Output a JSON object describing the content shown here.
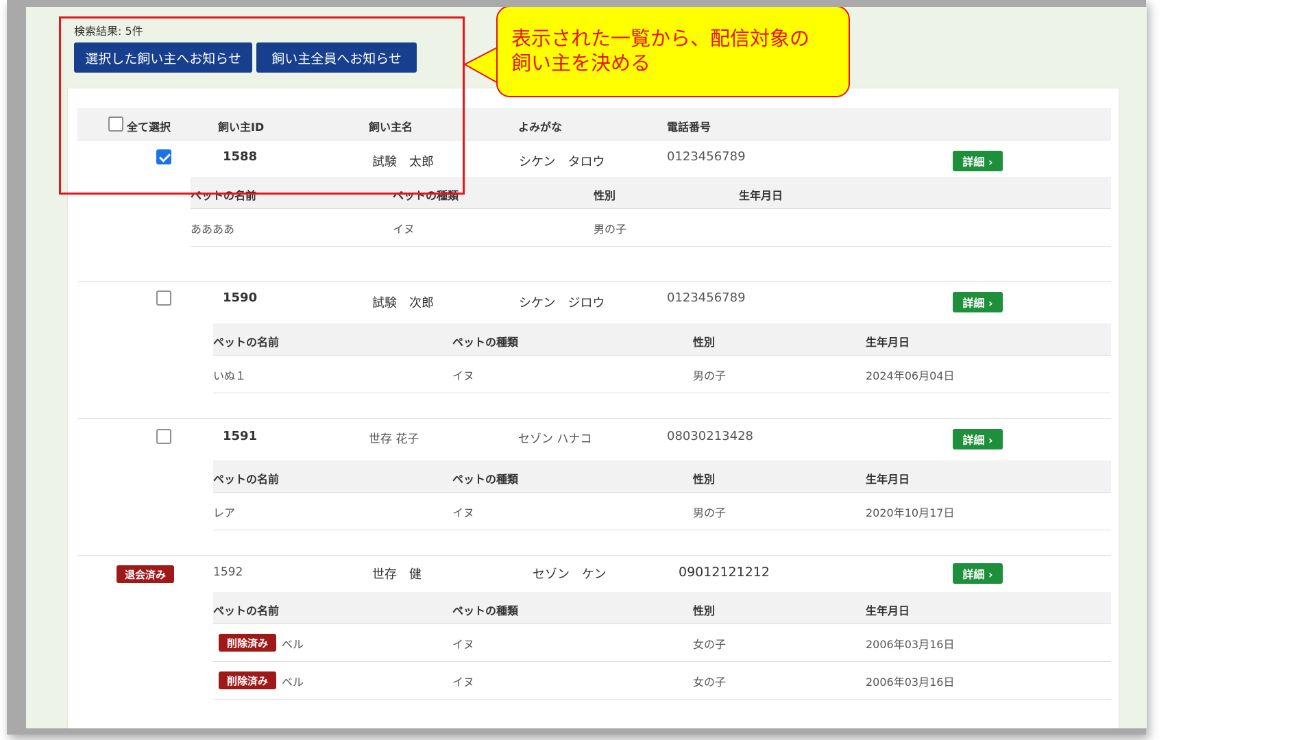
{
  "search": {
    "result_count": "検索結果: 5件"
  },
  "actions": {
    "notify_selected": "選択した飼い主へお知らせ",
    "notify_all": "飼い主全員へお知らせ"
  },
  "callout": {
    "line1": "表示された一覧から、配信対象の",
    "line2": "飼い主を決める"
  },
  "table_header": {
    "select_all": "全て選択",
    "owner_id": "飼い主ID",
    "owner_name": "飼い主名",
    "kana": "よみがな",
    "phone": "電話番号"
  },
  "pet_header": {
    "name": "ペットの名前",
    "type": "ペットの種類",
    "sex": "性別",
    "birthday": "生年月日"
  },
  "detail_label": "詳細 ›",
  "retired_label": "退会済み",
  "deleted_label": "削除済み",
  "owners": [
    {
      "id": "1588",
      "name": "試験　太郎",
      "kana": "シケン　タロウ",
      "phone": "0123456789",
      "checked": true,
      "pets": [
        {
          "name": "ああああ",
          "type": "イヌ",
          "sex": "男の子",
          "birthday": ""
        }
      ]
    },
    {
      "id": "1590",
      "name": "試験　次郎",
      "kana": "シケン　ジロウ",
      "phone": "0123456789",
      "checked": false,
      "pets": [
        {
          "name": "いぬ１",
          "type": "イヌ",
          "sex": "男の子",
          "birthday": "2024年06月04日"
        }
      ]
    },
    {
      "id": "1591",
      "name": "世存 花子",
      "kana": "セゾン ハナコ",
      "phone": "08030213428",
      "checked": false,
      "pets": [
        {
          "name": "レア",
          "type": "イヌ",
          "sex": "男の子",
          "birthday": "2020年10月17日"
        }
      ]
    },
    {
      "id": "1592",
      "name": "世存　健",
      "kana": "セゾン　ケン",
      "phone": "09012121212",
      "retired": true,
      "pets": [
        {
          "name": "ベル",
          "type": "イヌ",
          "sex": "女の子",
          "birthday": "2006年03月16日",
          "deleted": true
        },
        {
          "name": "ベル",
          "type": "イヌ",
          "sex": "女の子",
          "birthday": "2006年03月16日",
          "deleted": true
        }
      ]
    }
  ]
}
